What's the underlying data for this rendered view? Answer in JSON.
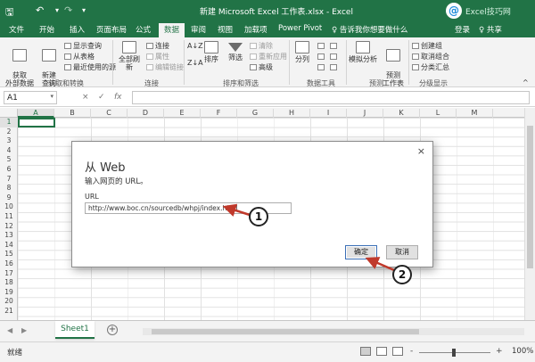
{
  "window": {
    "title": "新建 Microsoft Excel 工作表.xlsx - Excel",
    "watermark_text": "Excel技巧网"
  },
  "quick_access": {
    "save_icon": "save-icon",
    "undo_icon": "undo-icon",
    "redo_icon": "redo-icon",
    "customize_icon": "customize-qat-icon"
  },
  "tabs": [
    "文件",
    "开始",
    "插入",
    "页面布局",
    "公式",
    "数据",
    "审阅",
    "视图",
    "加载项",
    "Power Pivot"
  ],
  "active_tab": "数据",
  "tell_me": "♀ 告诉我你想要做什么",
  "account": {
    "login": "登录",
    "share": "♀ 共享"
  },
  "ribbon": {
    "get_external": "获取\n外部数据",
    "new_query": "新建\n查询",
    "show_queries": "显示查询",
    "from_table": "从表格",
    "recent_sources": "最近使用的源",
    "group_get_transform": "获取和转换",
    "refresh_all": "全部刷新",
    "connections": "连接",
    "properties": "属性",
    "edit_links": "编辑链接",
    "group_connections": "连接",
    "sort_az": "A↓Z",
    "sort_za": "Z↓A",
    "sort": "排序",
    "filter": "筛选",
    "clear": "清除",
    "reapply": "重新应用",
    "advanced": "高级",
    "group_sort_filter": "排序和筛选",
    "text_to_columns": "分列",
    "group_data_tools": "数据工具",
    "what_if": "模拟分析",
    "forecast_sheet": "预测\n工作表",
    "group_forecast": "预测",
    "group_outline_items": [
      "创建组",
      "取消组合",
      "分类汇总"
    ],
    "group_outline": "分级显示"
  },
  "formula_bar": {
    "name_box": "A1",
    "cancel": "×",
    "enter": "✓",
    "fx": "fx",
    "value": ""
  },
  "columns": [
    "A",
    "B",
    "C",
    "D",
    "E",
    "F",
    "G",
    "H",
    "I",
    "J",
    "K",
    "L",
    "M"
  ],
  "rows": [
    "1",
    "2",
    "3",
    "4",
    "5",
    "6",
    "7",
    "8",
    "9",
    "10",
    "11",
    "12",
    "13",
    "14",
    "15",
    "16",
    "17",
    "18",
    "19",
    "20",
    "21"
  ],
  "dialog": {
    "title": "从 Web",
    "prompt": "输入网页的 URL。",
    "url_label": "URL",
    "url_value": "http://www.boc.cn/sourcedb/whpj/index.html",
    "ok_label": "确定",
    "cancel_label": "取消",
    "close": "×"
  },
  "callouts": {
    "one": "1",
    "two": "2"
  },
  "sheet_tabs": [
    "Sheet1"
  ],
  "add_sheet": "+",
  "status": {
    "ready": "就绪",
    "zoom_minus": "-",
    "zoom_plus": "+",
    "zoom": "100%"
  },
  "colors": {
    "excel_green": "#217346",
    "ribbon_bg": "#f3f3f3",
    "dialog_border": "#8c8c8c"
  }
}
